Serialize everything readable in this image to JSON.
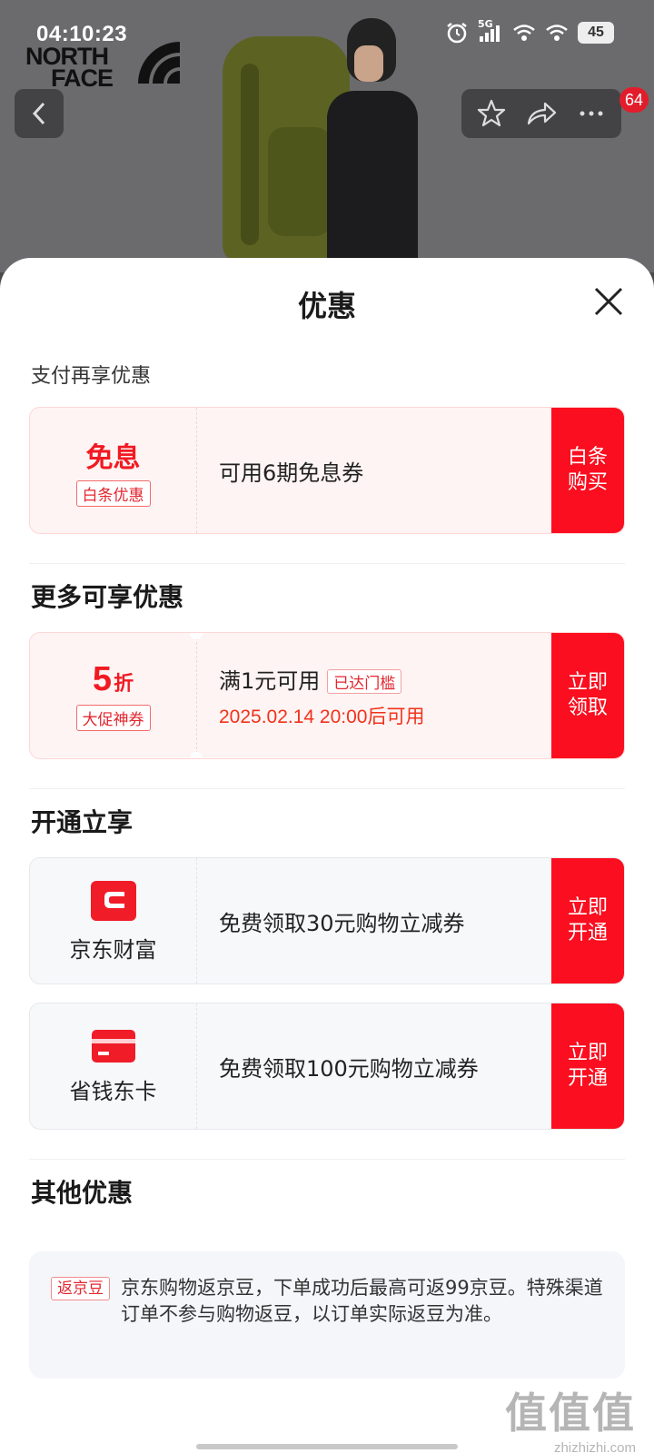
{
  "status_bar": {
    "time": "04:10:23",
    "network": "5G",
    "battery": "45"
  },
  "hero": {
    "brand_logo_text_line1": "NORTH",
    "brand_logo_text_line2": "FACE",
    "cart_badge": "64"
  },
  "sheet": {
    "title": "优惠",
    "section_pay": {
      "title": "支付再享优惠",
      "card": {
        "main": "免息",
        "tag": "白条优惠",
        "desc": "可用6期免息券",
        "cta": "白条购买"
      }
    },
    "section_more": {
      "title": "更多可享优惠",
      "card": {
        "discount_number": "5",
        "discount_unit": "折",
        "tag": "大促神券",
        "desc": "满1元可用",
        "threshold_tag": "已达门槛",
        "time_note": "2025.02.14 20:00后可用",
        "cta": "立即领取"
      }
    },
    "section_open": {
      "title": "开通立享",
      "cards": [
        {
          "brand": "京东财富",
          "desc": "免费领取30元购物立减券",
          "cta": "立即开通"
        },
        {
          "brand": "省钱东卡",
          "desc": "免费领取100元购物立减券",
          "cta": "立即开通"
        }
      ]
    },
    "section_other": {
      "title": "其他优惠",
      "tag": "返京豆",
      "text": "京东购物返京豆，下单成功后最高可返99京豆。特殊渠道订单不参与购物返豆，以订单实际返豆为准。"
    }
  },
  "watermark": {
    "main": "值值值",
    "sub": "zhizhizhi.com"
  },
  "colors": {
    "accent_red": "#fa0e1f",
    "text_red": "#f11a22",
    "card_pink_bg": "#fff4f4",
    "card_grey_bg": "#f7f8fa"
  }
}
